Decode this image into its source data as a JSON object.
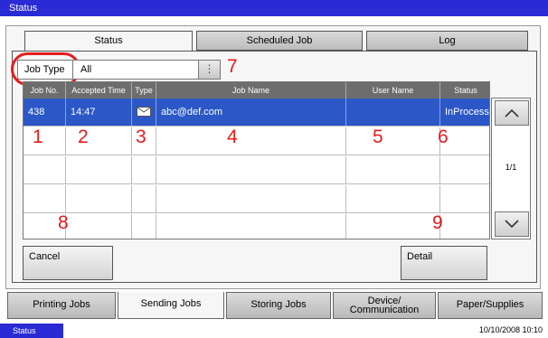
{
  "window": {
    "title": "Status"
  },
  "tabs_top": [
    "Status",
    "Scheduled Job",
    "Log"
  ],
  "filter": {
    "label": "Job Type",
    "value": "All"
  },
  "table": {
    "headers": [
      "Job No.",
      "Accepted Time",
      "Type",
      "Job Name",
      "User Name",
      "Status"
    ],
    "rows": [
      {
        "job_no": "438",
        "time": "14:47",
        "type_icon": "envelope-icon",
        "job_name": "abc@def.com",
        "user": "",
        "status": "InProcess"
      }
    ]
  },
  "callouts": [
    "1",
    "2",
    "3",
    "4",
    "5",
    "6",
    "7",
    "8",
    "9"
  ],
  "pagination": {
    "page": "1/1"
  },
  "buttons": {
    "cancel": "Cancel",
    "detail": "Detail"
  },
  "tabs_bottom": [
    "Printing Jobs",
    "Sending Jobs",
    "Storing Jobs",
    "Device/\nCommunication",
    "Paper/Supplies"
  ],
  "status_bar": {
    "label": "Status",
    "datetime": "10/10/2008   10:10"
  },
  "colors": {
    "title_blue": "#2b2bd6",
    "row_selected": "#2b57c7",
    "callout_red": "#e51c1c"
  }
}
